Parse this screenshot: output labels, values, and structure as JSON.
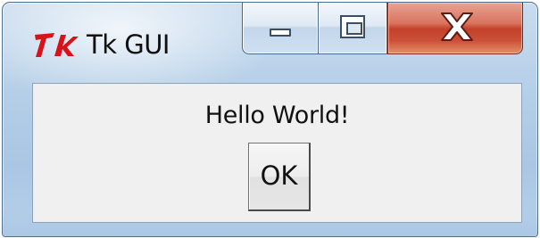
{
  "window": {
    "title": "Tk GUI",
    "app_icon": "tk-feather-icon",
    "caption_buttons": {
      "minimize_icon": "minimize-icon",
      "maximize_icon": "maximize-icon",
      "close_icon": "close-icon"
    }
  },
  "content": {
    "label": "Hello World!",
    "button_label": "OK"
  },
  "colors": {
    "close_button": "#c3412a",
    "icon_red": "#d9121a",
    "client_background": "#f0f0f0"
  }
}
